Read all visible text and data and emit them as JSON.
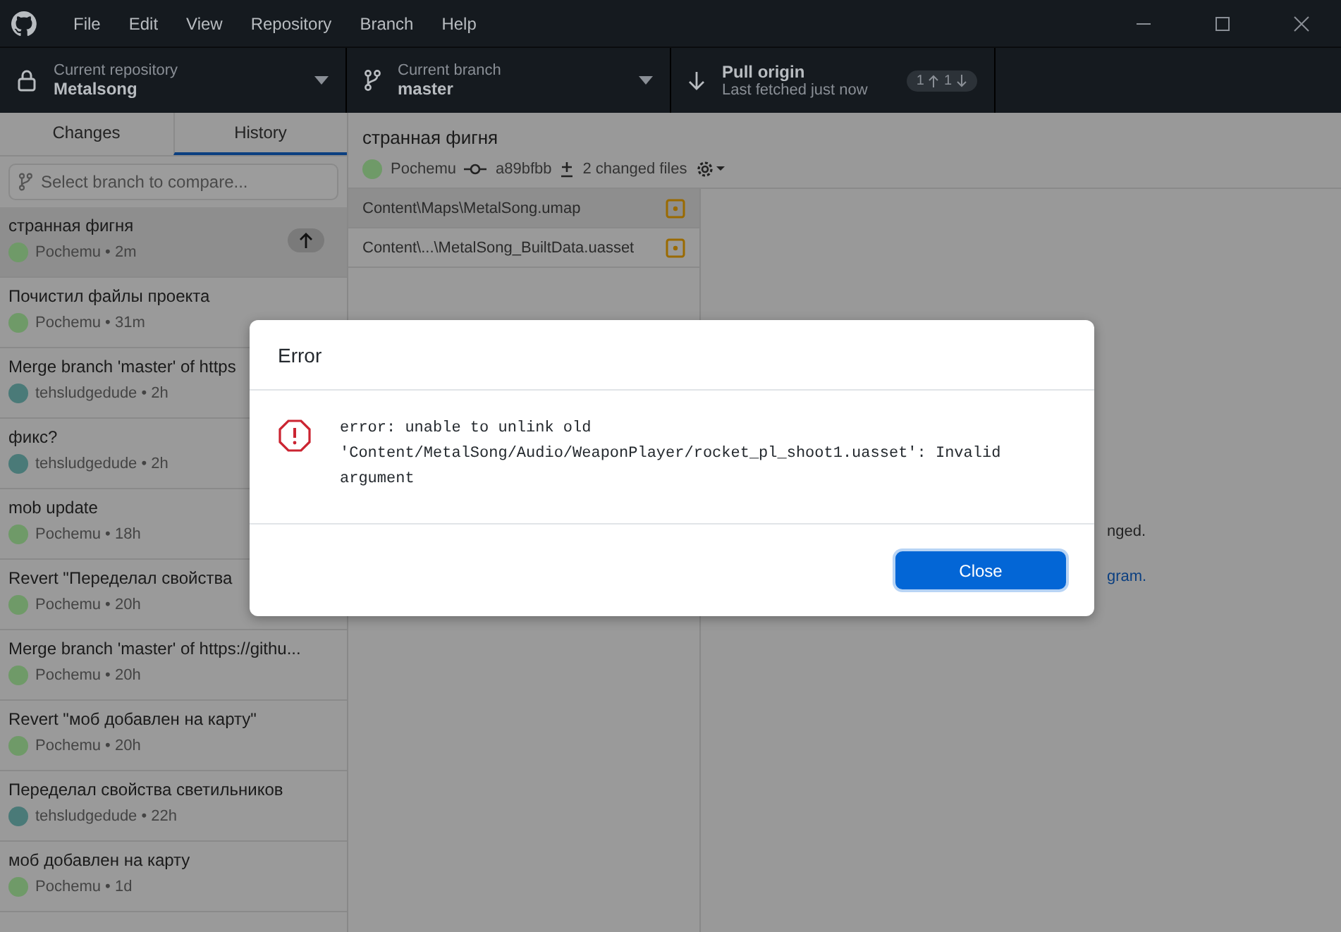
{
  "window": {
    "menu": [
      "File",
      "Edit",
      "View",
      "Repository",
      "Branch",
      "Help"
    ]
  },
  "toolbar": {
    "repository": {
      "label": "Current repository",
      "value": "Metalsong"
    },
    "branch": {
      "label": "Current branch",
      "value": "master"
    },
    "pull": {
      "title": "Pull origin",
      "subtitle": "Last fetched just now",
      "ahead": "1",
      "behind": "1"
    }
  },
  "sidebar": {
    "tabs": [
      {
        "label": "Changes",
        "selected": false
      },
      {
        "label": "History",
        "selected": true
      }
    ],
    "compare_placeholder": "Select branch to compare...",
    "commits": [
      {
        "title": "странная фигня",
        "author": "Pochemu",
        "time": "2m",
        "color": "#6f9a68",
        "selected": true,
        "unpushed": true
      },
      {
        "title": "Почистил файлы проекта",
        "author": "Pochemu",
        "time": "31m",
        "color": "#6f9a68",
        "selected": false,
        "unpushed": false
      },
      {
        "title": "Merge branch 'master' of https",
        "author": "tehsludgedude",
        "time": "2h",
        "color": "#4a7a78",
        "selected": false,
        "unpushed": false
      },
      {
        "title": "фикс?",
        "author": "tehsludgedude",
        "time": "2h",
        "color": "#4a7a78",
        "selected": false,
        "unpushed": false
      },
      {
        "title": "mob update",
        "author": "Pochemu",
        "time": "18h",
        "color": "#6f9a68",
        "selected": false,
        "unpushed": false
      },
      {
        "title": "Revert \"Переделал свойства",
        "author": "Pochemu",
        "time": "20h",
        "color": "#6f9a68",
        "selected": false,
        "unpushed": false
      },
      {
        "title": "Merge branch 'master' of https://githu...",
        "author": "Pochemu",
        "time": "20h",
        "color": "#6f9a68",
        "selected": false,
        "unpushed": false
      },
      {
        "title": "Revert \"моб добавлен на карту\"",
        "author": "Pochemu",
        "time": "20h",
        "color": "#6f9a68",
        "selected": false,
        "unpushed": false
      },
      {
        "title": "Переделал свойства светильников",
        "author": "tehsludgedude",
        "time": "22h",
        "color": "#4a7a78",
        "selected": false,
        "unpushed": false
      },
      {
        "title": "моб добавлен на карту",
        "author": "Pochemu",
        "time": "1d",
        "color": "#6f9a68",
        "selected": false,
        "unpushed": false
      }
    ]
  },
  "commit": {
    "title": "странная фигня",
    "author": "Pochemu",
    "sha": "a89bfbb",
    "changed_files": "2 changed files"
  },
  "files": [
    {
      "path": "Content\\Maps\\MetalSong.umap",
      "selected": true
    },
    {
      "path": "Content\\...\\MetalSong_BuiltData.uasset",
      "selected": false
    }
  ],
  "meta_separator": "•",
  "background_text": [
    {
      "text": "nged.",
      "kind": "text"
    },
    {
      "text": "gram.",
      "kind": "link"
    }
  ],
  "dialog": {
    "title": "Error",
    "message": "error: unable to unlink old 'Content/MetalSong/Audio/WeaponPlayer/rocket_pl_shoot1.uasset': Invalid argument",
    "buttons": [
      "Close"
    ]
  }
}
